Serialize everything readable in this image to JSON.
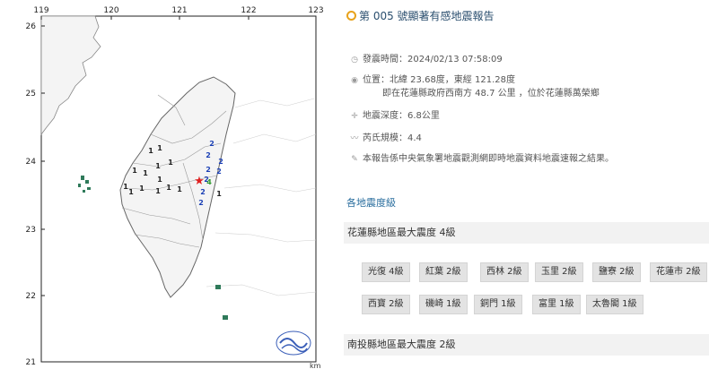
{
  "map": {
    "lon_ticks": [
      "119",
      "120",
      "121",
      "122",
      "123"
    ],
    "lat_ticks": [
      "26",
      "25",
      "24",
      "23",
      "22",
      "21"
    ],
    "unit_label": "km",
    "epicenter_symbol": "★",
    "intensity_labels": [
      {
        "v": "2",
        "c": "#1a3fb5"
      },
      {
        "v": "2",
        "c": "#1a3fb5"
      },
      {
        "v": "2",
        "c": "#1a3fb5"
      },
      {
        "v": "2",
        "c": "#1a3fb5"
      },
      {
        "v": "2",
        "c": "#1a3fb5"
      },
      {
        "v": "2",
        "c": "#1a3fb5"
      },
      {
        "v": "4",
        "c": "#2e9a2e"
      },
      {
        "v": "2",
        "c": "#1a3fb5"
      },
      {
        "v": "2",
        "c": "#1a3fb5"
      },
      {
        "v": "1",
        "c": "#222"
      },
      {
        "v": "1",
        "c": "#222"
      },
      {
        "v": "1",
        "c": "#222"
      },
      {
        "v": "1",
        "c": "#222"
      },
      {
        "v": "1",
        "c": "#222"
      },
      {
        "v": "1",
        "c": "#222"
      },
      {
        "v": "1",
        "c": "#222"
      },
      {
        "v": "1",
        "c": "#222"
      },
      {
        "v": "1",
        "c": "#222"
      },
      {
        "v": "1",
        "c": "#222"
      },
      {
        "v": "1",
        "c": "#222"
      },
      {
        "v": "1",
        "c": "#222"
      },
      {
        "v": "1",
        "c": "#222"
      },
      {
        "v": "1",
        "c": "#222"
      }
    ],
    "colors": {
      "land": "#f4f4f4",
      "sea": "#ffffff",
      "border": "#777777",
      "epicenter": "#e02020"
    }
  },
  "report": {
    "title": "第 005 號顯著有感地震報告",
    "time_label": "發震時間：",
    "time_value": "2024/02/13 07:58:09",
    "location_label": "位置：",
    "location_value": "北緯 23.68度，東經 121.28度",
    "location_detail": "即在花蓮縣政府西南方 48.7 公里 ，位於花蓮縣萬榮鄉",
    "depth_label": "地震深度：",
    "depth_value": "6.8公里",
    "magnitude_label": "芮氏規模：",
    "magnitude_value": "4.4",
    "note": "本報告係中央氣象署地震觀測網即時地震資料地震速報之結果。",
    "section_title": "各地震度級",
    "counties": [
      {
        "name": "花蓮縣地區最大震度 4級",
        "stations": [
          "光復 4級",
          "紅葉 2級",
          "西林 2級",
          "玉里 2級",
          "鹽寮 2級",
          "花蓮市 2級",
          "西寶 2級",
          "磯崎 1級",
          "銅門 1級",
          "富里 1級",
          "太魯閣 1級"
        ]
      },
      {
        "name": "南投縣地區最大震度 2級",
        "stations": []
      }
    ],
    "colors": {
      "title": "#2a4e6e",
      "accent": "#e8a21b",
      "section": "#2a6e9e"
    }
  }
}
